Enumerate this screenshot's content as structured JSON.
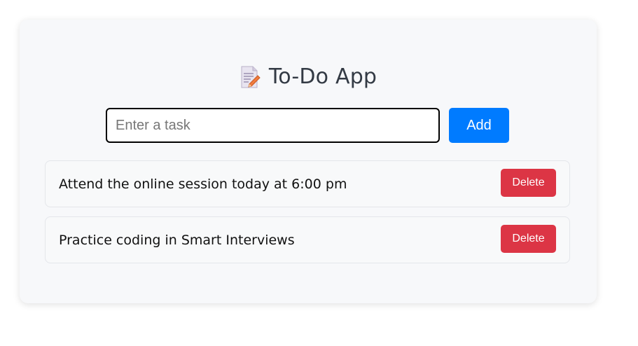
{
  "app": {
    "title": "To-Do App",
    "title_icon": "memo-icon"
  },
  "form": {
    "input_placeholder": "Enter a task",
    "input_value": "",
    "add_label": "Add"
  },
  "tasks": [
    {
      "text": "Attend the online session today at 6:00 pm",
      "delete_label": "Delete"
    },
    {
      "text": "Practice coding in Smart Interviews",
      "delete_label": "Delete"
    }
  ],
  "colors": {
    "add_button": "#007bff",
    "delete_button": "#dc3545",
    "card_background": "#f7f8fa"
  }
}
